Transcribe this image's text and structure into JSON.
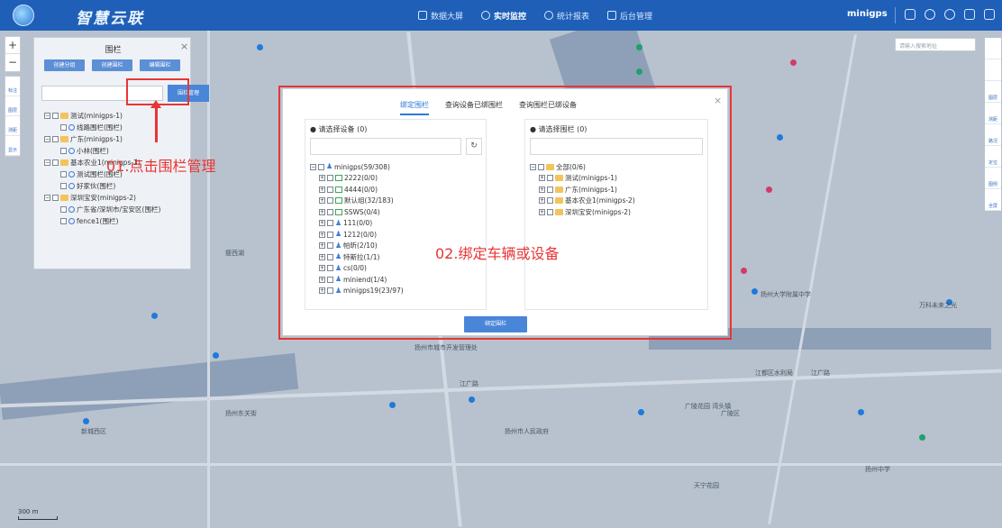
{
  "app": {
    "title": "智慧云联",
    "user": "minigps",
    "nav": [
      {
        "label": "数据大屏",
        "active": false
      },
      {
        "label": "实时监控",
        "active": true
      },
      {
        "label": "统计报表",
        "active": false
      },
      {
        "label": "后台管理",
        "active": false
      }
    ]
  },
  "map": {
    "search_placeholder": "请输入搜索地址",
    "zoom_in": "+",
    "zoom_out": "−",
    "left_tools": [
      "标注",
      "图层",
      "测距",
      "显示"
    ],
    "right_tools": [
      "",
      "",
      "图层",
      "测距",
      "路况",
      "定位",
      "图例",
      "全屏"
    ],
    "scale_label": "300 m",
    "labels": [
      "江广路",
      "江广路",
      "扬州市城市开发管理处",
      "瘦西湖",
      "广陵区",
      "天宁花园",
      "万科未来之光",
      "扬州大学附属中学",
      "江都区水利局",
      "扬州中学",
      "广陵花园 湾头镇",
      "新城西区",
      "扬州东关街",
      "扬州市人民政府"
    ]
  },
  "fence_panel": {
    "title": "围栏",
    "buttons": [
      "创建分组",
      "创建围栏",
      "编辑围栏"
    ],
    "search_placeholder": "",
    "manage_button": "围栏管理",
    "tree": [
      {
        "label": "测试(minigps-1)",
        "level": 0,
        "type": "folder"
      },
      {
        "label": "线路围栏(围栏)",
        "level": 1,
        "type": "fence"
      },
      {
        "label": "广东(minigps-1)",
        "level": 0,
        "type": "folder"
      },
      {
        "label": "小林(围栏)",
        "level": 1,
        "type": "fence"
      },
      {
        "label": "基本农业1(minigps-1)",
        "level": 0,
        "type": "folder"
      },
      {
        "label": "测试围栏(围栏)",
        "level": 1,
        "type": "fence"
      },
      {
        "label": "好家伙(围栏)",
        "level": 1,
        "type": "fence"
      },
      {
        "label": "深圳宝安(minigps-2)",
        "level": 0,
        "type": "folder"
      },
      {
        "label": "广东省/深圳市/宝安区(围栏)",
        "level": 1,
        "type": "fence"
      },
      {
        "label": "fence1(围栏)",
        "level": 1,
        "type": "fence"
      }
    ]
  },
  "annotations": {
    "step1": "01.点击围栏管理",
    "step2": "02.绑定车辆或设备"
  },
  "dialog": {
    "tabs": [
      {
        "label": "绑定围栏",
        "active": true
      },
      {
        "label": "查询设备已绑围栏",
        "active": false
      },
      {
        "label": "查询围栏已绑设备",
        "active": false
      }
    ],
    "close": "×",
    "left": {
      "header": "请选择设备 (0)",
      "search_placeholder": "",
      "tree": [
        {
          "label": "minigps(59/308)",
          "level": 0,
          "type": "person"
        },
        {
          "label": "2222(0/0)",
          "level": 1,
          "type": "car"
        },
        {
          "label": "4444(0/0)",
          "level": 1,
          "type": "car"
        },
        {
          "label": "默认组(32/183)",
          "level": 1,
          "type": "car"
        },
        {
          "label": "SSWS(0/4)",
          "level": 1,
          "type": "car"
        },
        {
          "label": "111(0/0)",
          "level": 1,
          "type": "person"
        },
        {
          "label": "1212(0/0)",
          "level": 1,
          "type": "person"
        },
        {
          "label": "帕昕(2/10)",
          "level": 1,
          "type": "person"
        },
        {
          "label": "特斯拉(1/1)",
          "level": 1,
          "type": "person"
        },
        {
          "label": "cs(0/0)",
          "level": 1,
          "type": "person"
        },
        {
          "label": "miniend(1/4)",
          "level": 1,
          "type": "person"
        },
        {
          "label": "minigps19(23/97)",
          "level": 1,
          "type": "person"
        }
      ]
    },
    "right": {
      "header": "请选择围栏 (0)",
      "search_placeholder": "",
      "tree": [
        {
          "label": "全部(0/6)",
          "level": 0,
          "type": "folder"
        },
        {
          "label": "测试(minigps-1)",
          "level": 1,
          "type": "folder"
        },
        {
          "label": "广东(minigps-1)",
          "level": 1,
          "type": "folder"
        },
        {
          "label": "基本农业1(minigps-2)",
          "level": 1,
          "type": "folder"
        },
        {
          "label": "深圳宝安(minigps-2)",
          "level": 1,
          "type": "folder"
        }
      ]
    },
    "bind_button": "绑定围栏"
  },
  "colors": {
    "topbar": "#1f5fb8",
    "accent": "#2f78d6",
    "annotation_red": "#e83535"
  }
}
